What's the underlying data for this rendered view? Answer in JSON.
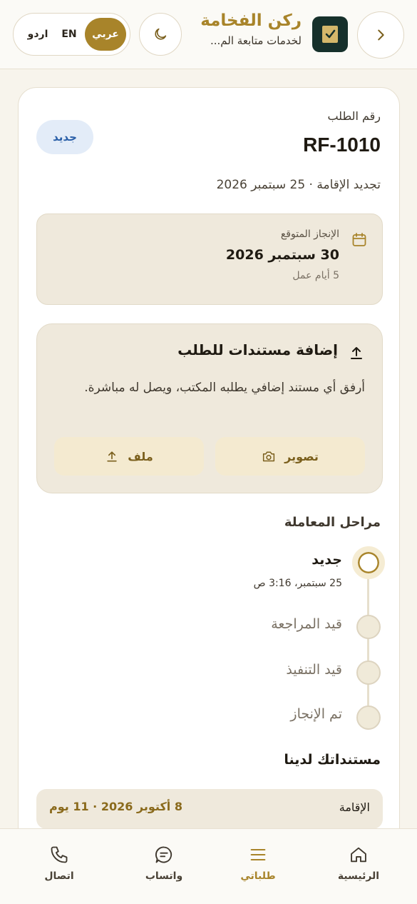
{
  "header": {
    "brand_title": "ركن الفخامة",
    "brand_subtitle": "لخدمات متابعة الم...",
    "languages": [
      "عربي",
      "EN",
      "اردو"
    ],
    "active_language": "عربي"
  },
  "request": {
    "number_label": "رقم الطلب",
    "number": "RF-1010",
    "status_badge": "جديد",
    "meta": "تجديد الإقامة · 25 سبتمبر 2026",
    "eta_label": "الإنجاز المتوقع",
    "eta_date": "30 سبتمبر 2026",
    "eta_days": "5 أيام عمل"
  },
  "add_docs": {
    "title": "إضافة مستندات للطلب",
    "description": "أرفق أي مستند إضافي يطلبه المكتب، ويصل له مباشرة.",
    "photo_label": "تصوير",
    "file_label": "ملف"
  },
  "stages": {
    "title": "مراحل المعاملة",
    "items": [
      {
        "name": "جديد",
        "time": "25 سبتمبر، 3:16 ص",
        "current": true
      },
      {
        "name": "قيد المراجعة"
      },
      {
        "name": "قيد التنفيذ"
      },
      {
        "name": "تم الإنجاز"
      }
    ]
  },
  "my_docs": {
    "title": "مستنداتك لدينا",
    "items": [
      {
        "name": "الإقامة",
        "expiry": "8 أكتوبر 2026 · 11 يوم"
      }
    ]
  },
  "nav": {
    "items": [
      {
        "label": "الرئيسية",
        "icon": "home-icon"
      },
      {
        "label": "طلباتي",
        "icon": "list-icon",
        "active": true
      },
      {
        "label": "واتساب",
        "icon": "chat-icon"
      },
      {
        "label": "اتصال",
        "icon": "phone-icon"
      }
    ]
  },
  "colors": {
    "accent": "#a8842a",
    "badge_blue": "#2a5fa8",
    "dark_logo": "#16302b"
  }
}
